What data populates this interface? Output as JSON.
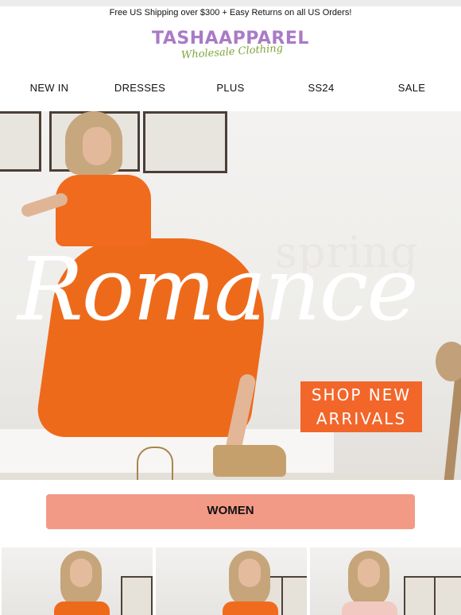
{
  "announcement": "Free US Shipping over $300 + Easy Returns on all US Orders!",
  "logo": {
    "main": "TASHAAPPAREL",
    "tagline": "Wholesale Clothing",
    "main_color": "#a97bc6",
    "tagline_color": "#7fa63a"
  },
  "nav": {
    "items": [
      {
        "label": "NEW IN"
      },
      {
        "label": "DRESSES"
      },
      {
        "label": "PLUS"
      },
      {
        "label": "SS24"
      },
      {
        "label": "SALE"
      }
    ]
  },
  "hero": {
    "headline_small": "spring",
    "headline_large": "Romance",
    "cta_line1": "SHOP NEW",
    "cta_line2": "ARRIVALS",
    "cta_color": "#f2662a",
    "dress_color": "#ee6a1b"
  },
  "women_button": {
    "label": "WOMEN",
    "color": "#f29a86"
  },
  "product_thumbnails": [
    {
      "dress_color": "#ee6a1b"
    },
    {
      "dress_color": "#f06b1d"
    },
    {
      "dress_color": "#f2c9c0"
    }
  ]
}
